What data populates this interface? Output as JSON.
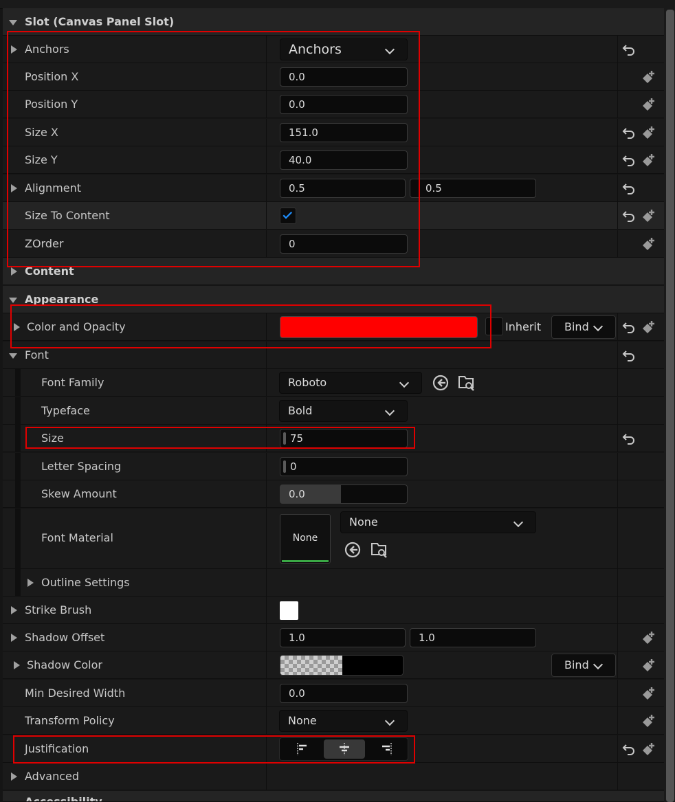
{
  "sections": {
    "slot": "Slot (Canvas Panel Slot)",
    "content": "Content",
    "appearance": "Appearance",
    "advanced": "Advanced",
    "accessibility": "Accessibility"
  },
  "slot": {
    "anchors": {
      "label": "Anchors",
      "value": "Anchors"
    },
    "position_x": {
      "label": "Position X",
      "value": "0.0"
    },
    "position_y": {
      "label": "Position Y",
      "value": "0.0"
    },
    "size_x": {
      "label": "Size X",
      "value": "151.0"
    },
    "size_y": {
      "label": "Size Y",
      "value": "40.0"
    },
    "alignment": {
      "label": "Alignment",
      "x": "0.5",
      "y": "0.5"
    },
    "size_to_content": {
      "label": "Size To Content",
      "checked": true
    },
    "zorder": {
      "label": "ZOrder",
      "value": "0"
    }
  },
  "appearance": {
    "color_opacity": {
      "label": "Color and Opacity",
      "color": "#ff0000",
      "inherit_label": "Inherit",
      "bind_label": "Bind"
    },
    "font": {
      "label": "Font",
      "family": {
        "label": "Font Family",
        "value": "Roboto"
      },
      "typeface": {
        "label": "Typeface",
        "value": "Bold"
      },
      "size": {
        "label": "Size",
        "value": "75"
      },
      "letter_spacing": {
        "label": "Letter Spacing",
        "value": "0"
      },
      "skew_amount": {
        "label": "Skew Amount",
        "value": "0.0"
      },
      "font_material": {
        "label": "Font Material",
        "thumb": "None",
        "value": "None"
      },
      "outline": {
        "label": "Outline Settings"
      }
    },
    "strike_brush": {
      "label": "Strike Brush"
    },
    "shadow_offset": {
      "label": "Shadow Offset",
      "x": "1.0",
      "y": "1.0"
    },
    "shadow_color": {
      "label": "Shadow Color",
      "bind_label": "Bind"
    },
    "min_desired_width": {
      "label": "Min Desired Width",
      "value": "0.0"
    },
    "transform_policy": {
      "label": "Transform Policy",
      "value": "None"
    },
    "justification": {
      "label": "Justification",
      "selected": "center"
    }
  },
  "colors": {
    "accent_check": "#1e8fff",
    "highlight": "#e00000",
    "slider_fill": "#3a3a3a"
  }
}
